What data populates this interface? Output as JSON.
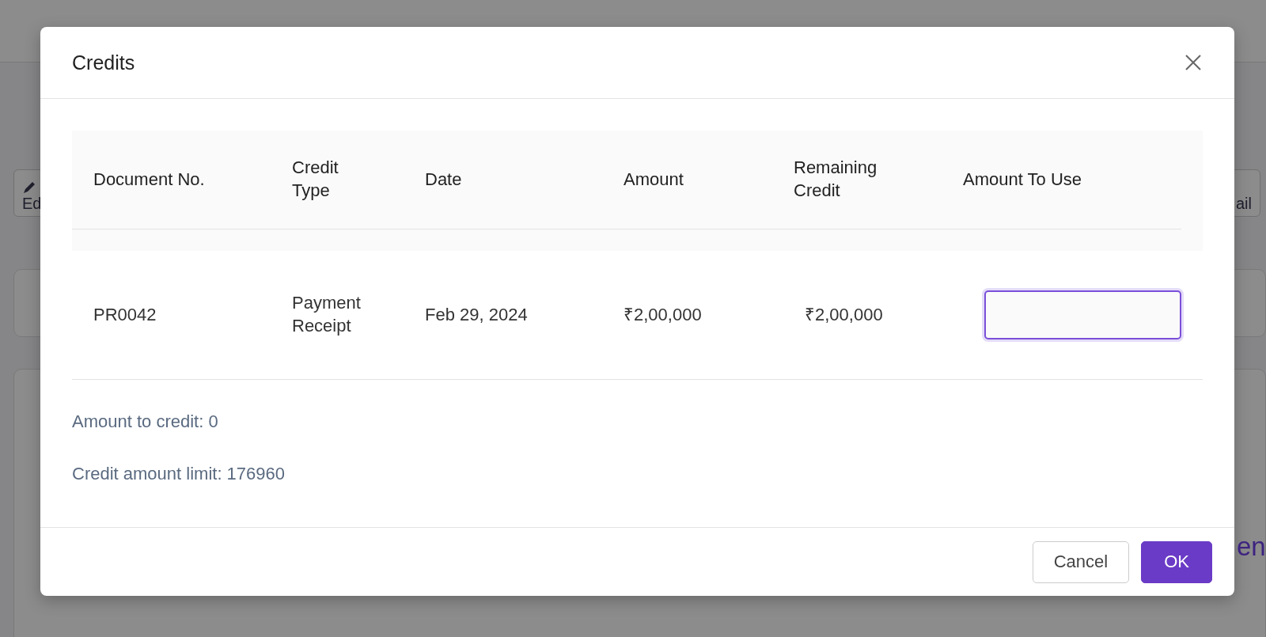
{
  "background": {
    "left_button": "Ed",
    "right_button": "ail",
    "heading_fragment": "en"
  },
  "dialog": {
    "title": "Credits",
    "table": {
      "columns": [
        "Document No.",
        "Credit Type",
        "Date",
        "Amount",
        "Remaining Credit",
        "Amount To Use"
      ],
      "rows": [
        {
          "document_no": "PR0042",
          "credit_type": "Payment Receipt",
          "date": "Feb 29, 2024",
          "amount": "₹2,00,000",
          "remaining_credit": "₹2,00,000",
          "amount_to_use": ""
        }
      ]
    },
    "summary": [
      "Amount to credit: 0",
      "Credit amount limit: 176960"
    ],
    "buttons": [
      {
        "label": "Cancel",
        "kind": "secondary"
      },
      {
        "label": "OK",
        "kind": "primary"
      }
    ]
  }
}
